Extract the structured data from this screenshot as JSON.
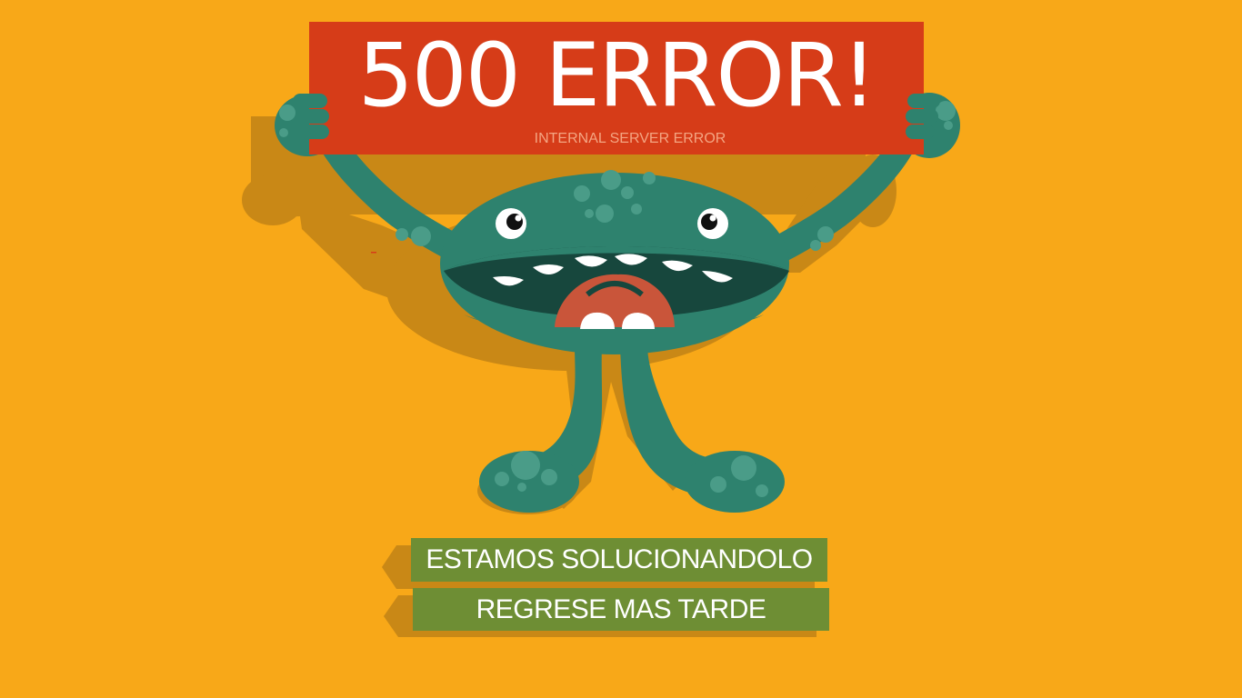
{
  "sign": {
    "title": "500 ERROR!",
    "subtitle": "INTERNAL SERVER ERROR"
  },
  "banners": [
    {
      "text": "ESTAMOS SOLUCIONANDOLO"
    },
    {
      "text": "REGRESE MAS TARDE"
    }
  ],
  "colors": {
    "background": "#F8A818",
    "shadow": "#C98816",
    "sign": "#D63C18",
    "monster": "#2E826E",
    "monster_spot": "#4A9C88",
    "mouth": "#17473D",
    "tongue": "#C9553A",
    "banner": "#6E8E34"
  },
  "icons": {
    "mascot": "monster-illustration"
  }
}
